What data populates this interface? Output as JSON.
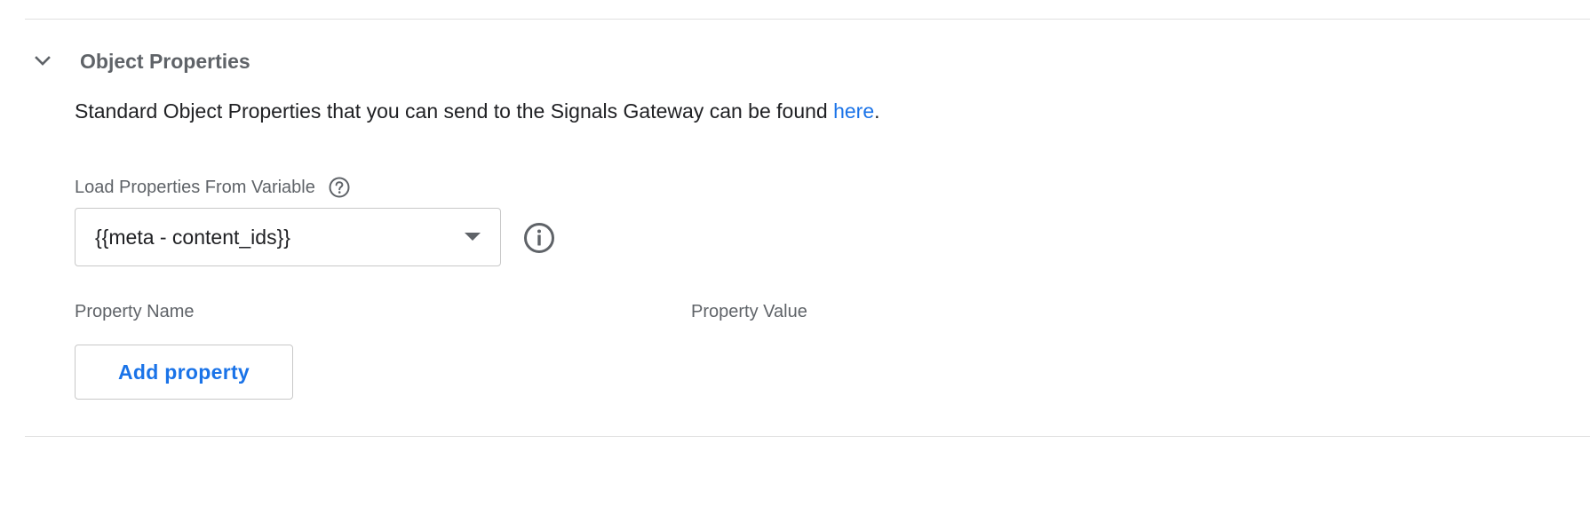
{
  "section": {
    "title": "Object Properties",
    "expanded": true,
    "description_prefix": "Standard Object Properties that you can send to the Signals Gateway can be found ",
    "description_link": "here",
    "description_suffix": "."
  },
  "load_properties": {
    "label": "Load Properties From Variable",
    "help_icon": "help-circle-icon",
    "selected_value": "{{meta - content_ids}}",
    "info_icon": "info-circle-icon"
  },
  "table": {
    "columns": [
      "Property Name",
      "Property Value"
    ]
  },
  "actions": {
    "add_property_label": "Add property"
  },
  "colors": {
    "link": "#1a73e8",
    "text_primary": "#202124",
    "text_secondary": "#5f6368",
    "border": "#c8c8c8",
    "divider": "#e0e0e0"
  }
}
